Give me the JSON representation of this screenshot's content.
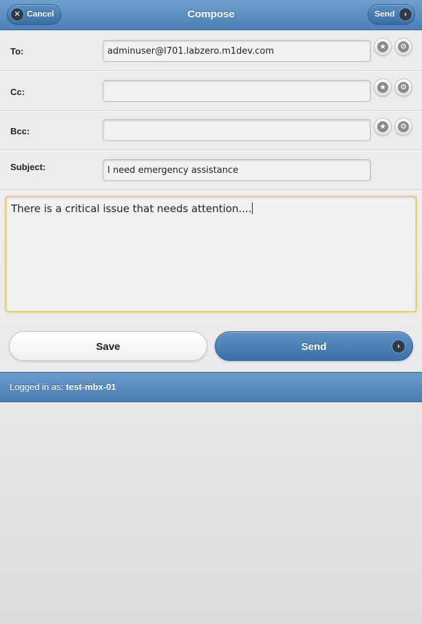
{
  "header": {
    "title": "Compose",
    "cancel_label": "Cancel",
    "send_label": "Send"
  },
  "form": {
    "to": {
      "label": "To:",
      "value": "adminuser@l701.labzero.m1dev.com"
    },
    "cc": {
      "label": "Cc:",
      "value": ""
    },
    "bcc": {
      "label": "Bcc:",
      "value": ""
    },
    "subject": {
      "label": "Subject:",
      "value": "I need emergency assistance"
    },
    "body": "There is a critical issue that needs attention...."
  },
  "actions": {
    "save_label": "Save",
    "send_label": "Send"
  },
  "footer": {
    "prefix": "Logged in as: ",
    "username": "test-mbx-01"
  },
  "colors": {
    "header_blue": "#4b7fb6",
    "focus_border": "#e0b64a"
  },
  "icons": {
    "cancel": "close-circle-icon",
    "send": "chevron-right-circle-icon",
    "favorite": "star-icon",
    "settings": "gear-icon"
  }
}
